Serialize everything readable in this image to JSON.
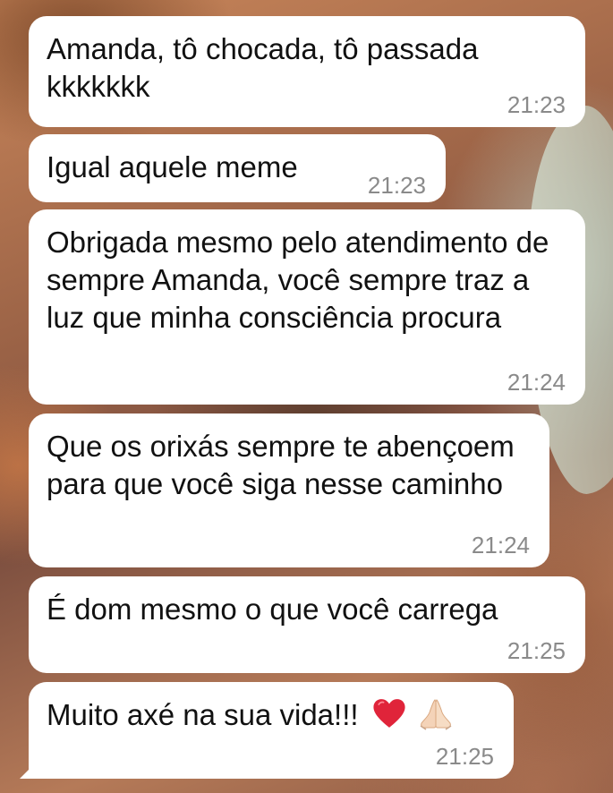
{
  "messages": [
    {
      "text": "Amanda, tô chocada, tô passada kkkkkkk",
      "time": "21:23"
    },
    {
      "text": "Igual aquele meme",
      "time": "21:23"
    },
    {
      "text": "Obrigada mesmo pelo atendimento de sempre Amanda, você sempre traz a luz que minha consciência procura",
      "time": "21:24"
    },
    {
      "text": "Que os orixás sempre te abençoem para que você siga nesse caminho",
      "time": "21:24"
    },
    {
      "text": "É dom mesmo o que você carrega",
      "time": "21:25"
    },
    {
      "text": "Muito axé na sua vida!!!",
      "emojis": [
        "red-heart",
        "folded-hands"
      ],
      "time": "21:25"
    }
  ],
  "colors": {
    "bubble": "#ffffff",
    "text": "#111111",
    "timestamp": "#8a8a8a",
    "heart": "#e0243a"
  }
}
